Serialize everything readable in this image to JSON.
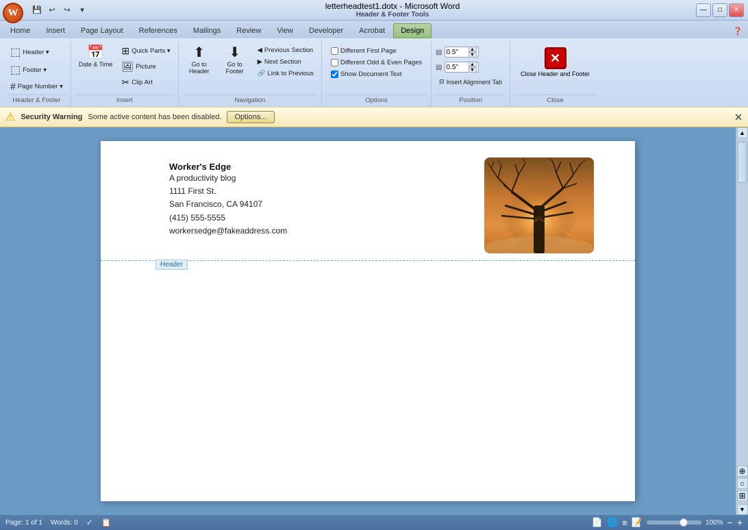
{
  "titlebar": {
    "title": "letterheadtest1.dotx - Microsoft Word",
    "tools_title": "Header & Footer Tools",
    "min_btn": "—",
    "max_btn": "□",
    "close_btn": "✕"
  },
  "quick_access": {
    "buttons": [
      "💾",
      "↩",
      "↪"
    ]
  },
  "tabs": [
    {
      "label": "Home",
      "key": "H",
      "active": false
    },
    {
      "label": "Insert",
      "key": "N",
      "active": false
    },
    {
      "label": "Page Layout",
      "key": "P",
      "active": false
    },
    {
      "label": "References",
      "key": "S",
      "active": false
    },
    {
      "label": "Mailings",
      "key": "M",
      "active": false
    },
    {
      "label": "Review",
      "key": "R",
      "active": false
    },
    {
      "label": "View",
      "key": "W",
      "active": false
    },
    {
      "label": "Developer",
      "key": "L",
      "active": false
    },
    {
      "label": "Acrobat",
      "key": "B",
      "active": false
    },
    {
      "label": "Design",
      "key": "JH",
      "active": true,
      "highlight": true
    }
  ],
  "ribbon": {
    "groups": {
      "header_footer": {
        "label": "Header & Footer",
        "header_btn": "Header ▾",
        "footer_btn": "Footer ▾",
        "page_number_btn": "Page Number ▾"
      },
      "insert": {
        "label": "Insert",
        "date_time": "Date & Time",
        "quick_parts": "Quick Parts ▾",
        "picture": "Picture",
        "clip_art": "Clip Art"
      },
      "navigation": {
        "label": "Navigation",
        "go_to_header": "Go to Header",
        "go_to_footer": "Go to Footer",
        "previous_section": "Previous Section",
        "next_section": "Next Section",
        "link_to_previous": "Link to Previous"
      },
      "options": {
        "label": "Options",
        "different_first_page": "Different First Page",
        "different_odd_even": "Different Odd & Even Pages",
        "show_document_text": "Show Document Text",
        "show_doc_checked": true
      },
      "position": {
        "label": "Position",
        "top_value": "0.5\"",
        "bottom_value": "0.5\""
      },
      "close": {
        "label": "Close",
        "close_header_footer": "Close Header and Footer"
      }
    }
  },
  "security_bar": {
    "icon": "⚠",
    "title": "Security Warning",
    "message": "Some active content has been disabled.",
    "options_btn": "Options...",
    "close_btn": "✕"
  },
  "document": {
    "company_name": "Worker's Edge",
    "tagline": "A productivity blog",
    "address1": "1111 First St.",
    "address2": "San Francisco, CA 94107",
    "phone": "(415) 555-5555",
    "email": "workersedge@fakeaddress.com",
    "header_label": "Header"
  },
  "status_bar": {
    "page_info": "Page: 1 of 1",
    "words": "Words: 0",
    "zoom_pct": "100%"
  }
}
